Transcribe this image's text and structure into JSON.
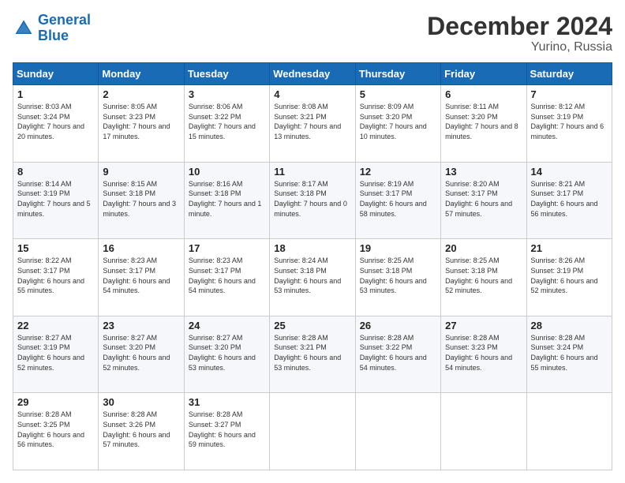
{
  "logo": {
    "line1": "General",
    "line2": "Blue"
  },
  "title": "December 2024",
  "subtitle": "Yurino, Russia",
  "days_header": [
    "Sunday",
    "Monday",
    "Tuesday",
    "Wednesday",
    "Thursday",
    "Friday",
    "Saturday"
  ],
  "weeks": [
    [
      {
        "day": "1",
        "sunrise": "Sunrise: 8:03 AM",
        "sunset": "Sunset: 3:24 PM",
        "daylight": "Daylight: 7 hours and 20 minutes."
      },
      {
        "day": "2",
        "sunrise": "Sunrise: 8:05 AM",
        "sunset": "Sunset: 3:23 PM",
        "daylight": "Daylight: 7 hours and 17 minutes."
      },
      {
        "day": "3",
        "sunrise": "Sunrise: 8:06 AM",
        "sunset": "Sunset: 3:22 PM",
        "daylight": "Daylight: 7 hours and 15 minutes."
      },
      {
        "day": "4",
        "sunrise": "Sunrise: 8:08 AM",
        "sunset": "Sunset: 3:21 PM",
        "daylight": "Daylight: 7 hours and 13 minutes."
      },
      {
        "day": "5",
        "sunrise": "Sunrise: 8:09 AM",
        "sunset": "Sunset: 3:20 PM",
        "daylight": "Daylight: 7 hours and 10 minutes."
      },
      {
        "day": "6",
        "sunrise": "Sunrise: 8:11 AM",
        "sunset": "Sunset: 3:20 PM",
        "daylight": "Daylight: 7 hours and 8 minutes."
      },
      {
        "day": "7",
        "sunrise": "Sunrise: 8:12 AM",
        "sunset": "Sunset: 3:19 PM",
        "daylight": "Daylight: 7 hours and 6 minutes."
      }
    ],
    [
      {
        "day": "8",
        "sunrise": "Sunrise: 8:14 AM",
        "sunset": "Sunset: 3:19 PM",
        "daylight": "Daylight: 7 hours and 5 minutes."
      },
      {
        "day": "9",
        "sunrise": "Sunrise: 8:15 AM",
        "sunset": "Sunset: 3:18 PM",
        "daylight": "Daylight: 7 hours and 3 minutes."
      },
      {
        "day": "10",
        "sunrise": "Sunrise: 8:16 AM",
        "sunset": "Sunset: 3:18 PM",
        "daylight": "Daylight: 7 hours and 1 minute."
      },
      {
        "day": "11",
        "sunrise": "Sunrise: 8:17 AM",
        "sunset": "Sunset: 3:18 PM",
        "daylight": "Daylight: 7 hours and 0 minutes."
      },
      {
        "day": "12",
        "sunrise": "Sunrise: 8:19 AM",
        "sunset": "Sunset: 3:17 PM",
        "daylight": "Daylight: 6 hours and 58 minutes."
      },
      {
        "day": "13",
        "sunrise": "Sunrise: 8:20 AM",
        "sunset": "Sunset: 3:17 PM",
        "daylight": "Daylight: 6 hours and 57 minutes."
      },
      {
        "day": "14",
        "sunrise": "Sunrise: 8:21 AM",
        "sunset": "Sunset: 3:17 PM",
        "daylight": "Daylight: 6 hours and 56 minutes."
      }
    ],
    [
      {
        "day": "15",
        "sunrise": "Sunrise: 8:22 AM",
        "sunset": "Sunset: 3:17 PM",
        "daylight": "Daylight: 6 hours and 55 minutes."
      },
      {
        "day": "16",
        "sunrise": "Sunrise: 8:23 AM",
        "sunset": "Sunset: 3:17 PM",
        "daylight": "Daylight: 6 hours and 54 minutes."
      },
      {
        "day": "17",
        "sunrise": "Sunrise: 8:23 AM",
        "sunset": "Sunset: 3:17 PM",
        "daylight": "Daylight: 6 hours and 54 minutes."
      },
      {
        "day": "18",
        "sunrise": "Sunrise: 8:24 AM",
        "sunset": "Sunset: 3:18 PM",
        "daylight": "Daylight: 6 hours and 53 minutes."
      },
      {
        "day": "19",
        "sunrise": "Sunrise: 8:25 AM",
        "sunset": "Sunset: 3:18 PM",
        "daylight": "Daylight: 6 hours and 53 minutes."
      },
      {
        "day": "20",
        "sunrise": "Sunrise: 8:25 AM",
        "sunset": "Sunset: 3:18 PM",
        "daylight": "Daylight: 6 hours and 52 minutes."
      },
      {
        "day": "21",
        "sunrise": "Sunrise: 8:26 AM",
        "sunset": "Sunset: 3:19 PM",
        "daylight": "Daylight: 6 hours and 52 minutes."
      }
    ],
    [
      {
        "day": "22",
        "sunrise": "Sunrise: 8:27 AM",
        "sunset": "Sunset: 3:19 PM",
        "daylight": "Daylight: 6 hours and 52 minutes."
      },
      {
        "day": "23",
        "sunrise": "Sunrise: 8:27 AM",
        "sunset": "Sunset: 3:20 PM",
        "daylight": "Daylight: 6 hours and 52 minutes."
      },
      {
        "day": "24",
        "sunrise": "Sunrise: 8:27 AM",
        "sunset": "Sunset: 3:20 PM",
        "daylight": "Daylight: 6 hours and 53 minutes."
      },
      {
        "day": "25",
        "sunrise": "Sunrise: 8:28 AM",
        "sunset": "Sunset: 3:21 PM",
        "daylight": "Daylight: 6 hours and 53 minutes."
      },
      {
        "day": "26",
        "sunrise": "Sunrise: 8:28 AM",
        "sunset": "Sunset: 3:22 PM",
        "daylight": "Daylight: 6 hours and 54 minutes."
      },
      {
        "day": "27",
        "sunrise": "Sunrise: 8:28 AM",
        "sunset": "Sunset: 3:23 PM",
        "daylight": "Daylight: 6 hours and 54 minutes."
      },
      {
        "day": "28",
        "sunrise": "Sunrise: 8:28 AM",
        "sunset": "Sunset: 3:24 PM",
        "daylight": "Daylight: 6 hours and 55 minutes."
      }
    ],
    [
      {
        "day": "29",
        "sunrise": "Sunrise: 8:28 AM",
        "sunset": "Sunset: 3:25 PM",
        "daylight": "Daylight: 6 hours and 56 minutes."
      },
      {
        "day": "30",
        "sunrise": "Sunrise: 8:28 AM",
        "sunset": "Sunset: 3:26 PM",
        "daylight": "Daylight: 6 hours and 57 minutes."
      },
      {
        "day": "31",
        "sunrise": "Sunrise: 8:28 AM",
        "sunset": "Sunset: 3:27 PM",
        "daylight": "Daylight: 6 hours and 59 minutes."
      },
      null,
      null,
      null,
      null
    ]
  ]
}
